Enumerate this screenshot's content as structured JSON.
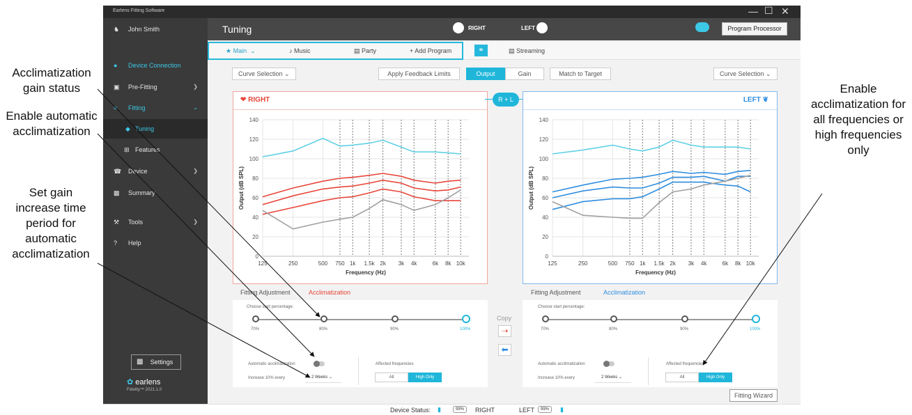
{
  "window": {
    "app_title": "Earlens Fitting Software",
    "minimize": "—",
    "maximize": "☐",
    "close": "✕"
  },
  "sidebar": {
    "user": "John Smith",
    "items": [
      {
        "label": "Device Connection",
        "icon": "ear-icon"
      },
      {
        "label": "Pre-Fitting",
        "icon": "clipboard-icon"
      },
      {
        "label": "Fitting",
        "icon": "sliders-icon"
      },
      {
        "label": "Tuning"
      },
      {
        "label": "Features",
        "icon": "plus-box-icon"
      },
      {
        "label": "Device",
        "icon": "device-icon"
      },
      {
        "label": "Summary",
        "icon": "document-icon"
      },
      {
        "label": "Tools",
        "icon": "wrench-icon"
      },
      {
        "label": "Help",
        "icon": "question-icon"
      }
    ],
    "settings": "Settings",
    "brand": "earlens",
    "version": "Fidelity™ 2021.1.0"
  },
  "header": {
    "title": "Tuning",
    "right": "RIGHT",
    "left": "LEFT",
    "program_processor": "Program Processor"
  },
  "tabs": {
    "main": "Main",
    "music": "Music",
    "party": "Party",
    "add_program": "+ Add Program",
    "streaming": "Streaming"
  },
  "toolbar": {
    "curve_selection": "Curve Selection",
    "apply_feedback": "Apply Feedback Limits",
    "output": "Output",
    "gain": "Gain",
    "match_target": "Match to Target",
    "rl": "R + L"
  },
  "right_panel": {
    "title": "RIGHT",
    "color": "#e8463a"
  },
  "left_panel": {
    "title": "LEFT",
    "color": "#2f8ee0"
  },
  "chart_data": [
    {
      "type": "line",
      "title": "RIGHT",
      "xlabel": "Frequency (Hz)",
      "ylabel": "Output (dB SPL)",
      "categories": [
        "125",
        "250",
        "500",
        "750",
        "1k",
        "1.5k",
        "2k",
        "3k",
        "4k",
        "6k",
        "8k",
        "10k"
      ],
      "ylim": [
        0,
        140
      ],
      "yticks": [
        0,
        20,
        40,
        60,
        80,
        100,
        120,
        140
      ],
      "series": [
        {
          "color": "#5fd0e6",
          "values": [
            102,
            108,
            121,
            113,
            114,
            116,
            119,
            112,
            107,
            107,
            106,
            105
          ]
        },
        {
          "color": "#e8463a",
          "values": [
            61,
            70,
            77,
            80,
            81,
            83,
            85,
            82,
            78,
            75,
            77,
            78
          ]
        },
        {
          "color": "#e8463a",
          "values": [
            53,
            62,
            69,
            71,
            72,
            75,
            78,
            75,
            70,
            67,
            68,
            71
          ]
        },
        {
          "color": "#e8463a",
          "values": [
            43,
            50,
            57,
            60,
            61,
            65,
            69,
            66,
            61,
            57,
            57,
            57
          ]
        },
        {
          "color": "#a0a0a0",
          "values": [
            47,
            28,
            35,
            38,
            40,
            49,
            58,
            53,
            47,
            53,
            60,
            68
          ]
        }
      ]
    },
    {
      "type": "line",
      "title": "LEFT",
      "xlabel": "Frequency (Hz)",
      "ylabel": "Output (dB SPL)",
      "categories": [
        "125",
        "250",
        "500",
        "750",
        "1k",
        "1.5k",
        "2k",
        "3k",
        "4k",
        "6k",
        "8k",
        "10k"
      ],
      "ylim": [
        0,
        140
      ],
      "yticks": [
        0,
        20,
        40,
        60,
        80,
        100,
        120,
        140
      ],
      "series": [
        {
          "color": "#5fd0e6",
          "values": [
            105,
            109,
            114,
            110,
            108,
            112,
            119,
            114,
            112,
            112,
            112,
            110
          ]
        },
        {
          "color": "#2f8ee0",
          "values": [
            66,
            73,
            79,
            80,
            81,
            84,
            87,
            85,
            86,
            84,
            87,
            88
          ]
        },
        {
          "color": "#2f8ee0",
          "values": [
            60,
            67,
            71,
            70,
            70,
            75,
            81,
            81,
            82,
            77,
            82,
            82
          ]
        },
        {
          "color": "#2f8ee0",
          "values": [
            48,
            56,
            59,
            59,
            61,
            69,
            76,
            76,
            76,
            73,
            72,
            66
          ]
        },
        {
          "color": "#a0a0a0",
          "values": [
            56,
            42,
            40,
            39,
            39,
            55,
            66,
            69,
            73,
            77,
            80,
            83
          ]
        }
      ]
    }
  ],
  "adjust": {
    "fitting_adjustment": "Fitting Adjustment",
    "acclimatization": "Acclimatization",
    "choose_start": "Choose start percentage:",
    "steps": [
      "70%",
      "80%",
      "90%",
      "100%"
    ],
    "auto_label": "Automatic acclimatization",
    "increase_label": "Increase 10% every",
    "period": "2 Weeks",
    "affected": "Affected frequencies",
    "all": "All",
    "high_only": "High Only"
  },
  "copy": {
    "label": "Copy"
  },
  "fitting_wizard": "Fitting Wizard",
  "status": {
    "device_status": "Device Status:",
    "right_batt": "99%",
    "right": "RIGHT",
    "left": "LEFT",
    "left_batt": "99%"
  },
  "annotations": {
    "a1": "Acclimatization gain status",
    "a2": "Enable automatic acclimatization",
    "a3": "Set gain increase time period for automatic acclimatization",
    "a4": "Enable acclimatization for all frequencies or high frequencies only"
  }
}
